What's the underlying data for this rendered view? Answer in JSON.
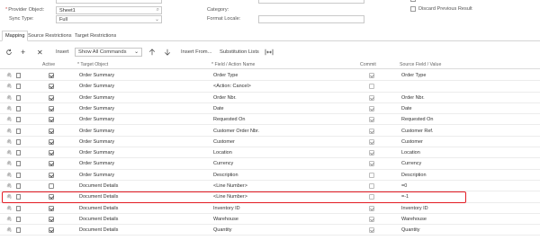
{
  "form": {
    "provider_object_label": "Provider Object:",
    "provider_object_value": "Sheet1",
    "sync_type_label": "Sync Type:",
    "sync_type_value": "Full",
    "category_label": "Category:",
    "format_locale_label": "Format Locale:",
    "format_locale_value": "",
    "discard_label": "Discard Previous Result"
  },
  "tabs": [
    {
      "label": "Mapping",
      "active": true
    },
    {
      "label": "Source Restrictions",
      "active": false
    },
    {
      "label": "Target Restrictions",
      "active": false
    }
  ],
  "toolbar": {
    "insert_label": "Insert",
    "show_select_value": "Show All Commands",
    "insert_from_label": "Insert From...",
    "substitution_label": "Substitution Lists"
  },
  "grid": {
    "columns": {
      "active": "Active",
      "target": "* Target Object",
      "field": "* Field / Action Name",
      "commit": "Commit",
      "source": "Source Field / Value"
    },
    "rows": [
      {
        "active": true,
        "target": "Order Summary",
        "field": "Order Type",
        "commit": true,
        "source": "Order Type"
      },
      {
        "active": true,
        "target": "Order Summary",
        "field": "<Action: Cancel>",
        "commit": false,
        "source": ""
      },
      {
        "active": true,
        "target": "Order Summary",
        "field": "Order Nbr.",
        "commit": true,
        "source": "Order Nbr."
      },
      {
        "active": true,
        "target": "Order Summary",
        "field": "Date",
        "commit": true,
        "source": "Date"
      },
      {
        "active": true,
        "target": "Order Summary",
        "field": "Requested On",
        "commit": true,
        "source": "Requested On"
      },
      {
        "active": true,
        "target": "Order Summary",
        "field": "Customer Order Nbr.",
        "commit": true,
        "source": "Customer Ref."
      },
      {
        "active": true,
        "target": "Order Summary",
        "field": "Customer",
        "commit": true,
        "source": "Customer"
      },
      {
        "active": true,
        "target": "Order Summary",
        "field": "Location",
        "commit": true,
        "source": "Location"
      },
      {
        "active": true,
        "target": "Order Summary",
        "field": "Currency",
        "commit": true,
        "source": "Currency"
      },
      {
        "active": true,
        "target": "Order Summary",
        "field": "Description",
        "commit": false,
        "source": "Description"
      },
      {
        "active": false,
        "target": "Document Details",
        "field": "<Line Number>",
        "commit": false,
        "source": "=0"
      },
      {
        "active": true,
        "target": "Document Details",
        "field": "<Line Number>",
        "commit": false,
        "source": "=-1",
        "highlight": true
      },
      {
        "active": true,
        "target": "Document Details",
        "field": "Inventory ID",
        "commit": true,
        "source": "Inventory ID"
      },
      {
        "active": true,
        "target": "Document Details",
        "field": "Warehouse",
        "commit": true,
        "source": "Warehouse"
      },
      {
        "active": true,
        "target": "Document Details",
        "field": "Quantity",
        "commit": true,
        "source": "Quantity"
      }
    ]
  },
  "colors": {
    "highlight": "#e31b23",
    "required": "#d9534f"
  },
  "icons": [
    "refresh-icon",
    "add-icon",
    "delete-icon",
    "chevron-down-icon",
    "arrow-up-icon",
    "arrow-down-icon",
    "fit-columns-icon",
    "attachment-icon",
    "note-icon",
    "search-icon"
  ]
}
